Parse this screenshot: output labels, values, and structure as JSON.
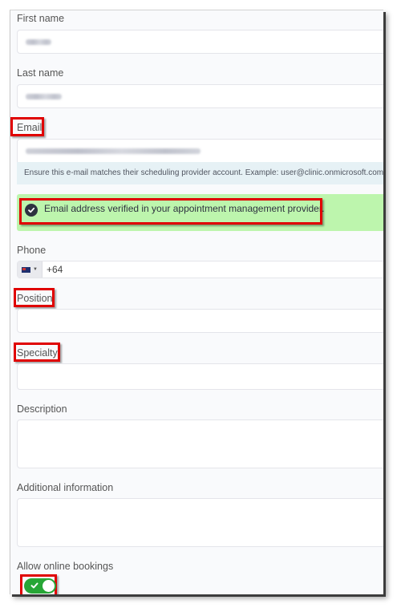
{
  "form": {
    "first_name": {
      "label": "First name",
      "value_redacted": true
    },
    "last_name": {
      "label": "Last name",
      "value_redacted": true
    },
    "email": {
      "label": "Email",
      "value_redacted": true,
      "hint": "Ensure this e-mail matches their scheduling provider account. Example: user@clinic.onmicrosoft.com",
      "verified_message": "Email address verified in your appointment management provider.",
      "verified_icon": "check-circle-icon"
    },
    "phone": {
      "label": "Phone",
      "country_flag": "new-zealand-flag-icon",
      "dropdown_icon": "caret-down-icon",
      "value": "+64"
    },
    "position": {
      "label": "Position",
      "value": ""
    },
    "specialty": {
      "label": "Specialty",
      "value": ""
    },
    "description": {
      "label": "Description",
      "value": ""
    },
    "additional_information": {
      "label": "Additional information",
      "value": ""
    },
    "allow_online_bookings": {
      "label": "Allow online bookings",
      "enabled": true
    }
  },
  "annotations": {
    "highlight_color": "#e00000",
    "highlighted": [
      "Email",
      "Email address verified in your appointment management provider.",
      "Position",
      "Specialty",
      "Allow online bookings toggle"
    ]
  },
  "colors": {
    "verified_background": "#bdf5ad",
    "hint_background": "#e6f1f5",
    "toggle_on": "#27a636"
  }
}
